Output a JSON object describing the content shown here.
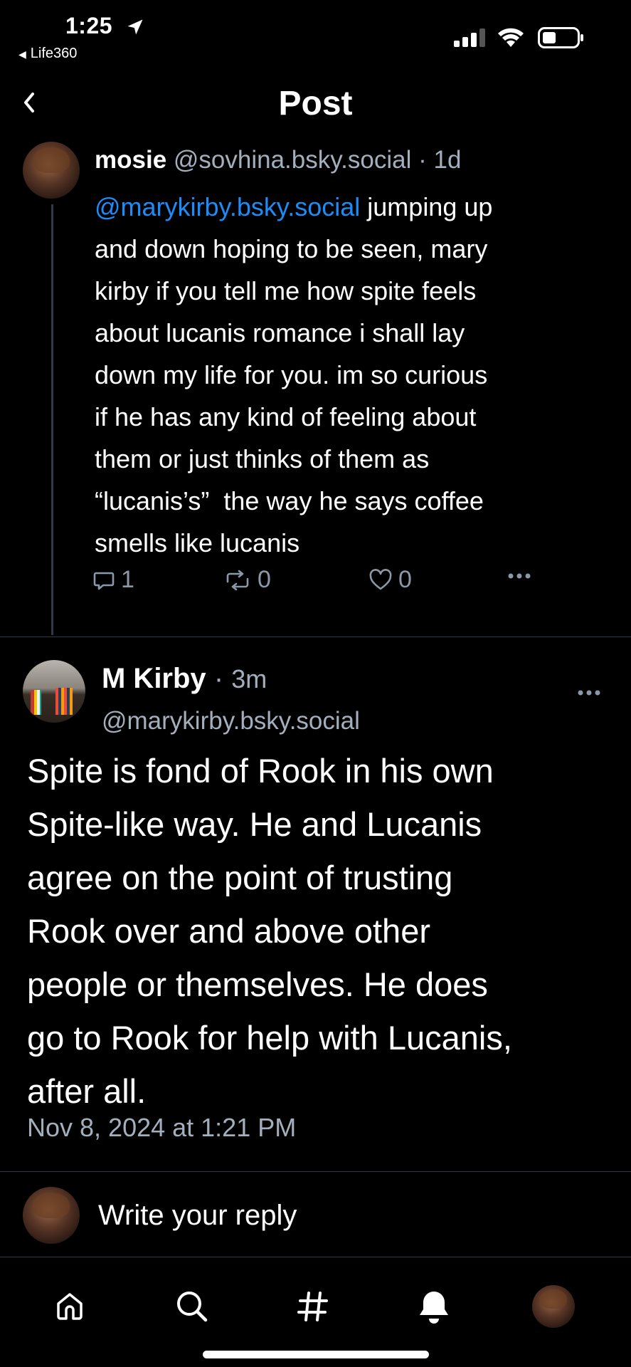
{
  "status_bar": {
    "time": "1:25",
    "back_app": "Life360"
  },
  "header": {
    "title": "Post",
    "back_icon": "chevron-left-icon"
  },
  "parent_post": {
    "display_name": "mosie",
    "handle": "@sovhina.bsky.social",
    "separator": "·",
    "age": "1d",
    "mention": "@marykirby.bsky.social",
    "text_lines": [
      " jumping up",
      "and down hoping to be seen, mary",
      "kirby if you tell me how spite feels",
      "about lucanis romance i shall lay",
      "down my life for you. im so curious",
      "if he has any kind of feeling about",
      "them or just thinks of them as",
      "“lucanis’s”  the way he says coffee",
      "smells like lucanis"
    ],
    "reply_count": "1",
    "repost_count": "0",
    "like_count": "0"
  },
  "main_post": {
    "display_name": "M Kirby",
    "separator": "·",
    "age": "3m",
    "handle": "@marykirby.bsky.social",
    "text_lines": [
      "Spite is fond of Rook in his own",
      "Spite-like way. He and Lucanis",
      "agree on the point of trusting",
      "Rook over and above other",
      "people or themselves. He does",
      "go to Rook for help with Lucanis,",
      "after all."
    ],
    "timestamp": "Nov 8, 2024 at 1:21 PM"
  },
  "reply_bar": {
    "placeholder": "Write your reply"
  },
  "bottom_nav": {
    "items": [
      "home-icon",
      "search-icon",
      "hashtag-icon",
      "notifications-icon",
      "profile-avatar"
    ]
  },
  "colors": {
    "background": "#000000",
    "accent": "#1d8cf8",
    "muted_text": "#a3afbd",
    "divider": "#2e3a47"
  }
}
